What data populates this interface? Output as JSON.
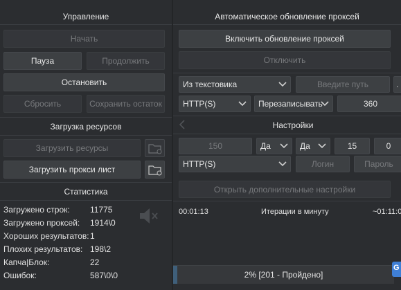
{
  "left": {
    "control_header": "Управление",
    "start": "Начать",
    "pause": "Пауза",
    "resume": "Продолжить",
    "stop": "Остановить",
    "reset": "Сбросить",
    "save_rest": "Сохранить остаток",
    "resources_header": "Загрузка ресурсов",
    "load_resources": "Загрузить ресурсы",
    "load_proxy_list": "Загрузить прокси лист",
    "stats_header": "Статистика",
    "stats": [
      {
        "label": "Загружено строк:",
        "value": "11775"
      },
      {
        "label": "Загружено проксей:",
        "value": "1914\\0"
      },
      {
        "label": "Хороших результатов:",
        "value": "1"
      },
      {
        "label": "Плохих результатов:",
        "value": "198\\2"
      },
      {
        "label": "Капча|Блок:",
        "value": "22"
      },
      {
        "label": "Ошибок:",
        "value": "587\\0\\0"
      }
    ]
  },
  "right": {
    "auto_update_header": "Автоматическое обновление проксей",
    "enable_update": "Включить обновление проксей",
    "disable": "Отключить",
    "source_select": "Из текстовика",
    "path_placeholder": "Введите путь",
    "protocol_select": "HTTP(S)",
    "mode_select": "Перезаписывать",
    "interval_value": "360",
    "settings_header": "Настройки",
    "settings_value1": "150",
    "yes_select_1": "Да",
    "yes_select_2": "Да",
    "settings_value2": "15",
    "settings_value3": "0",
    "protocol_select_2": "HTTP(S)",
    "login_placeholder": "Логин",
    "password_placeholder": "Пароль",
    "open_advanced": "Открыть дополнительные настройки",
    "elapsed_time": "00:01:13",
    "iterations_label": "Итерации в минуту",
    "remaining_time": "~01:11:0",
    "progress_text": "2% [201 - Пройдено]",
    "progress_percent": 2
  }
}
